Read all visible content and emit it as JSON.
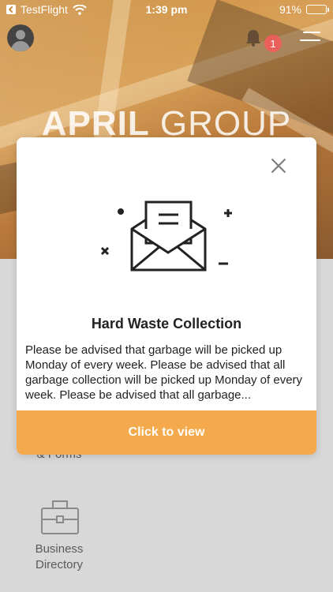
{
  "status_bar": {
    "back_app": "TestFlight",
    "time": "1:39 pm",
    "battery": "91%",
    "battery_level": 0.91
  },
  "header": {
    "notification_count": "1",
    "brand_strong": "APRIL",
    "brand_light": " GROUP"
  },
  "background_menu": {
    "partial_tile_label": "& Forms",
    "business_directory_label": "Business\nDirectory"
  },
  "modal": {
    "title": "Hard Waste Collection",
    "body": "Please be advised that garbage will be picked up Monday of every week. Please be advised that all garbage collection will be picked up Monday of every week. Please be advised that all garbage...",
    "cta_label": "Click to view"
  },
  "colors": {
    "accent": "#f3a94c",
    "badge": "#e9605a"
  }
}
